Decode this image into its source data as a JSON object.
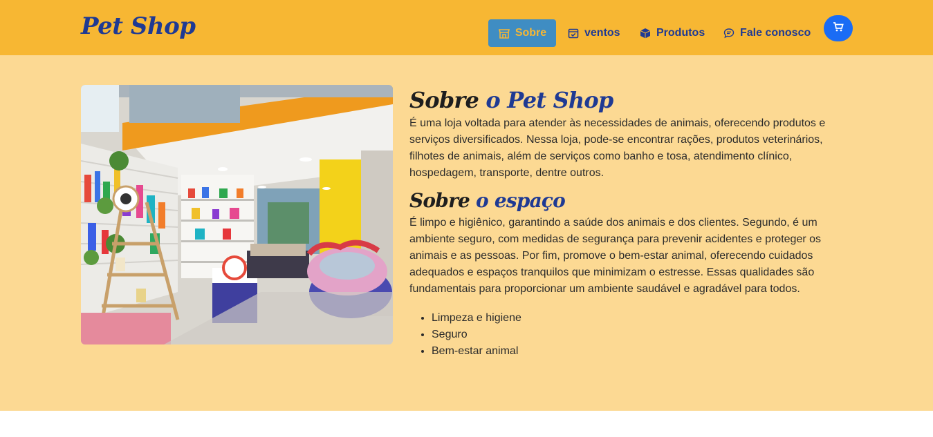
{
  "header": {
    "brand": "Pet Shop",
    "nav": [
      {
        "label": "Sobre",
        "icon": "store-icon",
        "active": true
      },
      {
        "label": "ventos",
        "icon": "calendar-check-icon"
      },
      {
        "label": "Produtos",
        "icon": "box-icon"
      },
      {
        "label": "Fale conosco",
        "icon": "chat-icon"
      }
    ],
    "cart_icon": "cart-icon"
  },
  "colors": {
    "navbar": "#f7b733",
    "section": "#fcd993",
    "brand": "#1f3a93",
    "active_nav_bg": "#3f8dc3",
    "cart_button": "#1a6cf5"
  },
  "about": {
    "title_prefix": "Sobre",
    "title_accent": "o Pet Shop",
    "paragraph": "É uma loja voltada para atender às necessidades de animais, oferecendo produtos e serviços diversificados. Nessa loja, pode-se encontrar rações, produtos veterinários, filhotes de animais, além de serviços como banho e tosa, atendimento clínico, hospedagem, transporte, dentre outros."
  },
  "space": {
    "title_prefix": "Sobre",
    "title_accent": "o espaço",
    "paragraph": "É limpo e higiênico, garantindo a saúde dos animais e dos clientes. Segundo, é um ambiente seguro, com medidas de segurança para prevenir acidentes e proteger os animais e as pessoas. Por fim, promove o bem-estar animal, oferecendo cuidados adequados e espaços tranquilos que minimizam o estresse. Essas qualidades são fundamentais para proporcionar um ambiente saudável e agradável para todos.",
    "items": [
      "Limpeza e higiene",
      "Seguro",
      "Bem-estar animal"
    ]
  }
}
